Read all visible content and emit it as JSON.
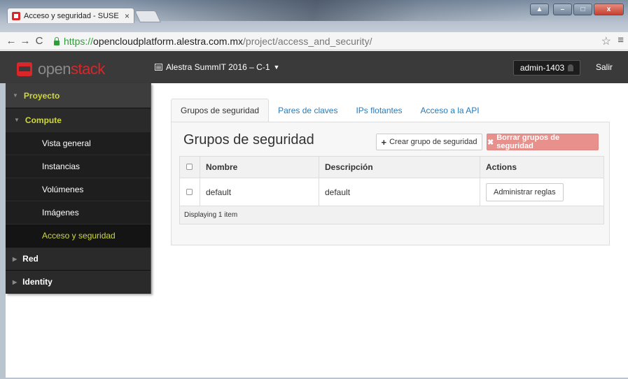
{
  "browser": {
    "tab_title": "Acceso y seguridad - SUSE",
    "tab_close": "×",
    "url_scheme": "https://",
    "url_host": "opencloudplatform.alestra.com.mx",
    "url_path": "/project/access_and_security/",
    "back_icon": "←",
    "forward_icon": "→",
    "reload_icon": "C",
    "star_icon": "☆",
    "menu_icon": "≡",
    "win_min": "–",
    "win_max": "□",
    "win_close": "x"
  },
  "header": {
    "logo_open": "open",
    "logo_stack": "stack",
    "project": "Alestra SummIT 2016 – C-1",
    "user": "admin-1403",
    "logout": "Salir"
  },
  "sidebar": {
    "project": "Proyecto",
    "compute": "Compute",
    "items": [
      "Vista general",
      "Instancias",
      "Volúmenes",
      "Imágenes",
      "Acceso y seguridad"
    ],
    "red": "Red",
    "identity": "Identity"
  },
  "tabs": [
    "Grupos de seguridad",
    "Pares de claves",
    "IPs flotantes",
    "Acceso a la API"
  ],
  "main": {
    "title": "Grupos de seguridad",
    "create_button": "Crear grupo de seguridad",
    "delete_button": "Borrar grupos de seguridad",
    "columns": [
      "Nombre",
      "Descripción",
      "Actions"
    ],
    "rows": [
      {
        "name": "default",
        "description": "default",
        "action": "Administrar reglas"
      }
    ],
    "footer": "Displaying 1 item"
  },
  "colors": {
    "accent": "#d9262b",
    "link": "#2a7ab8",
    "sidebar_active": "#d0d83a",
    "danger_button": "#e8908c"
  }
}
